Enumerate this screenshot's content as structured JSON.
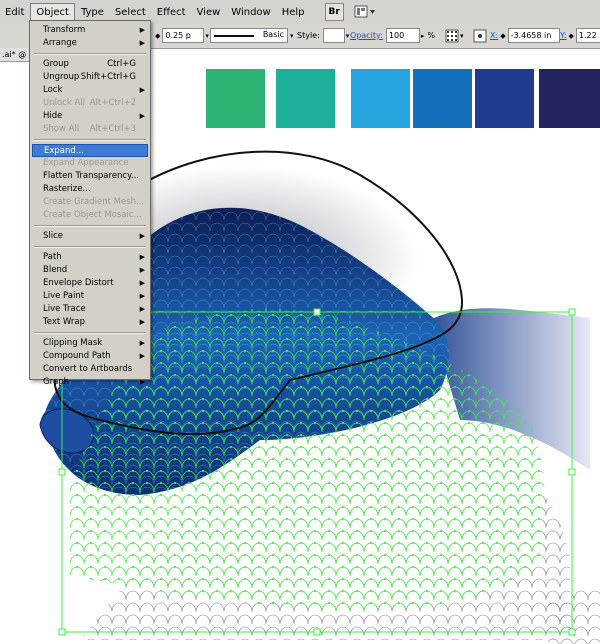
{
  "menubar": {
    "items": [
      "Edit",
      "Object",
      "Type",
      "Select",
      "Effect",
      "View",
      "Window",
      "Help"
    ],
    "active": "Object",
    "bridge_label": "Br"
  },
  "control_bar": {
    "stroke_weight": "0.25 p",
    "brush_style": "Basic",
    "style_label": "Style:",
    "opacity_label": "Opacity:",
    "opacity_value": "100",
    "opacity_unit": "%",
    "x_label": "X:",
    "x_value": "-3.4658 in",
    "y_label": "Y:",
    "y_value": "1.22"
  },
  "document_tab": {
    "label": ".ai* @"
  },
  "object_menu": [
    {
      "label": "Transform",
      "submenu": true
    },
    {
      "label": "Arrange",
      "submenu": true
    },
    {
      "separator": true
    },
    {
      "label": "Group",
      "shortcut": "Ctrl+G"
    },
    {
      "label": "Ungroup",
      "shortcut": "Shift+Ctrl+G"
    },
    {
      "label": "Lock",
      "submenu": true
    },
    {
      "label": "Unlock All",
      "shortcut": "Alt+Ctrl+2",
      "disabled": true
    },
    {
      "label": "Hide",
      "submenu": true
    },
    {
      "label": "Show All",
      "shortcut": "Alt+Ctrl+3",
      "disabled": true
    },
    {
      "separator": true
    },
    {
      "label": "Expand...",
      "highlighted": true
    },
    {
      "label": "Expand Appearance",
      "disabled": true
    },
    {
      "label": "Flatten Transparency..."
    },
    {
      "label": "Rasterize..."
    },
    {
      "label": "Create Gradient Mesh...",
      "disabled": true
    },
    {
      "label": "Create Object Mosaic...",
      "disabled": true
    },
    {
      "separator": true
    },
    {
      "label": "Slice",
      "submenu": true
    },
    {
      "separator": true
    },
    {
      "label": "Path",
      "submenu": true
    },
    {
      "label": "Blend",
      "submenu": true
    },
    {
      "label": "Envelope Distort",
      "submenu": true
    },
    {
      "label": "Live Paint",
      "submenu": true
    },
    {
      "label": "Live Trace",
      "submenu": true
    },
    {
      "label": "Text Wrap",
      "submenu": true
    },
    {
      "separator": true
    },
    {
      "label": "Clipping Mask",
      "submenu": true
    },
    {
      "label": "Compound Path",
      "submenu": true
    },
    {
      "label": "Convert to Artboards"
    },
    {
      "label": "Graph",
      "submenu": true
    }
  ],
  "swatches": [
    "#2db374",
    "#1caf9a",
    "#25a4de",
    "#1470ba",
    "#203a8f",
    "#22245f"
  ],
  "colors": {
    "menu_bg": "#d4d0c8",
    "highlight": "#3d7bd9",
    "selection_green": "#3cf23c",
    "fish_dark": "#0f2a6e",
    "fish_mid": "#1a5aa8"
  }
}
